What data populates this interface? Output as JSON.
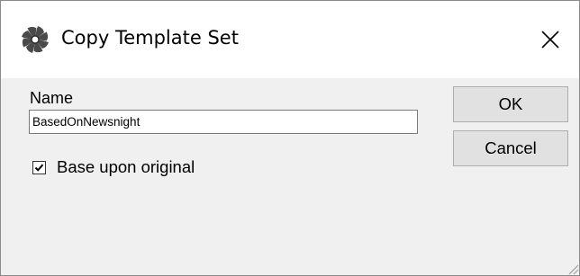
{
  "window": {
    "title": "Copy Template Set",
    "app_icon": "pinwheel-icon",
    "close_icon": "close-icon"
  },
  "form": {
    "name_label": "Name",
    "name_value": "BasedOnNewsnight",
    "checkbox_label": "Base upon original",
    "checkbox_checked": true
  },
  "buttons": {
    "ok_label": "OK",
    "cancel_label": "Cancel"
  },
  "grip_icon": "resize-grip-icon"
}
